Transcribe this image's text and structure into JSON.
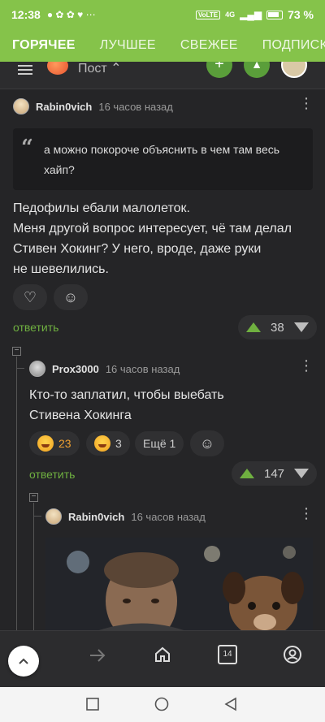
{
  "status_bar": {
    "time": "12:38",
    "battery": "73 %",
    "network": "4G",
    "vowifi": "VoLTE"
  },
  "tabs": [
    "ГОРЯЧЕЕ",
    "ЛУЧШЕЕ",
    "СВЕЖЕЕ",
    "ПОДПИСК"
  ],
  "header": {
    "title": "Пост"
  },
  "comments": [
    {
      "author": "Rabin0vich",
      "time": "16 часов назад",
      "quote": "а можно покороче объяснить в чем там весь хайп?",
      "text_lines": [
        "Педофилы ебали малолеток.",
        "Меня другой вопрос интересует, чё там делал",
        "Стивен Хокинг? У него, вроде, даже руки",
        "не шевелились."
      ],
      "reply_label": "ответить",
      "rating": "38"
    },
    {
      "author": "Prox3000",
      "time": "16 часов назад",
      "text_lines": [
        "Кто-то заплатил, чтобы выебать",
        "Стивена Хокинга"
      ],
      "reactions": [
        {
          "count": "23"
        },
        {
          "count": "3"
        }
      ],
      "more_reactions": "Ещё 1",
      "reply_label": "ответить",
      "rating": "147"
    },
    {
      "author": "Rabin0vich",
      "time": "16 часов назад"
    }
  ],
  "bottom_nav": {
    "badge": "14"
  },
  "colors": {
    "accent": "#85c34a",
    "background": "#252527",
    "upvote": "#6fb040"
  }
}
